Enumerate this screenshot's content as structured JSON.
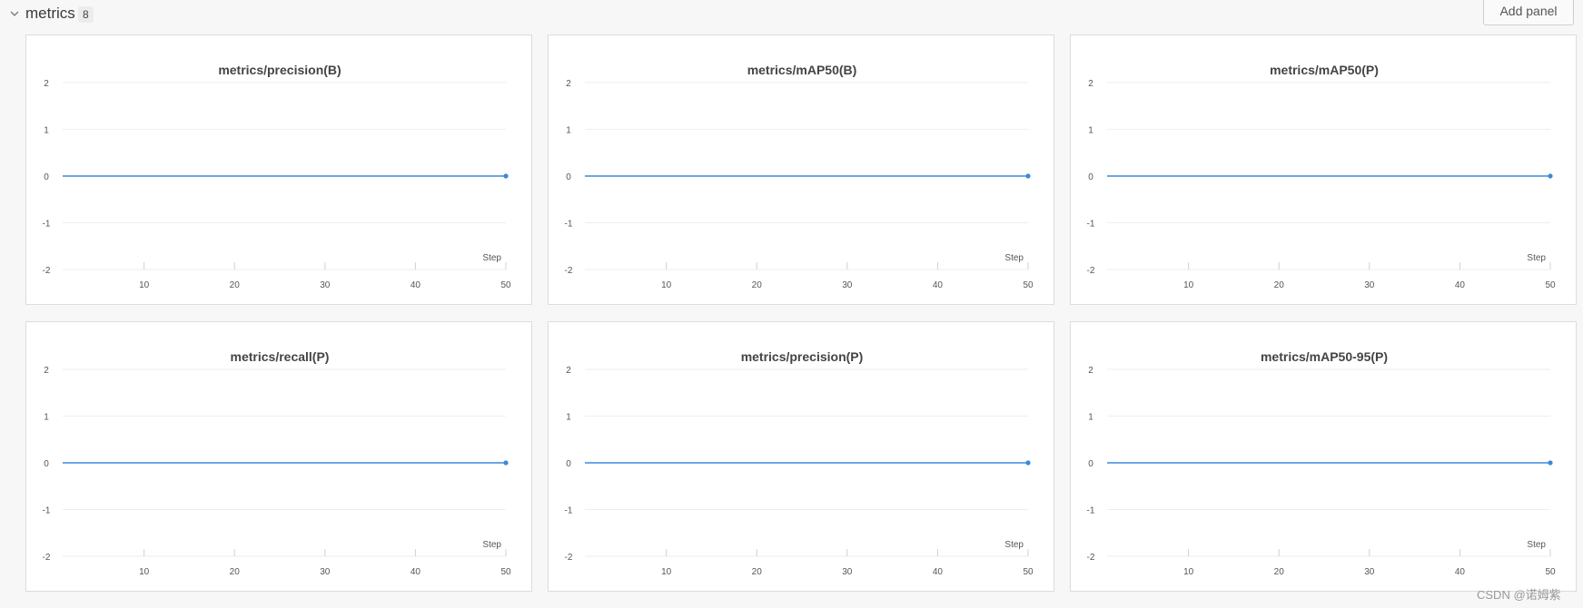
{
  "section": {
    "title": "metrics",
    "count": "8",
    "add_panel_label": "Add panel"
  },
  "colors": {
    "line": "#3a8ad6",
    "grid": "#eeeeee",
    "axis_text": "#555555"
  },
  "chart_data": [
    {
      "type": "line",
      "title": "metrics/precision(B)",
      "xlabel": "Step",
      "ylabel": "",
      "ylim": [
        -2,
        2
      ],
      "xlim": [
        1,
        50
      ],
      "yticks": [
        2,
        1,
        0,
        -1,
        -2
      ],
      "xticks": [
        10,
        20,
        30,
        40,
        50
      ],
      "grid": "horizontal",
      "series": [
        {
          "x": [
            1,
            50
          ],
          "y": [
            0,
            0
          ]
        }
      ]
    },
    {
      "type": "line",
      "title": "metrics/mAP50(B)",
      "xlabel": "Step",
      "ylabel": "",
      "ylim": [
        -2,
        2
      ],
      "xlim": [
        1,
        50
      ],
      "yticks": [
        2,
        1,
        0,
        -1,
        -2
      ],
      "xticks": [
        10,
        20,
        30,
        40,
        50
      ],
      "grid": "horizontal",
      "series": [
        {
          "x": [
            1,
            50
          ],
          "y": [
            0,
            0
          ]
        }
      ]
    },
    {
      "type": "line",
      "title": "metrics/mAP50(P)",
      "xlabel": "Step",
      "ylabel": "",
      "ylim": [
        -2,
        2
      ],
      "xlim": [
        1,
        50
      ],
      "yticks": [
        2,
        1,
        0,
        -1,
        -2
      ],
      "xticks": [
        10,
        20,
        30,
        40,
        50
      ],
      "grid": "horizontal",
      "series": [
        {
          "x": [
            1,
            50
          ],
          "y": [
            0,
            0
          ]
        }
      ]
    },
    {
      "type": "line",
      "title": "metrics/recall(P)",
      "xlabel": "Step",
      "ylabel": "",
      "ylim": [
        -2,
        2
      ],
      "xlim": [
        1,
        50
      ],
      "yticks": [
        2,
        1,
        0,
        -1,
        -2
      ],
      "xticks": [
        10,
        20,
        30,
        40,
        50
      ],
      "grid": "horizontal",
      "series": [
        {
          "x": [
            1,
            50
          ],
          "y": [
            0,
            0
          ]
        }
      ]
    },
    {
      "type": "line",
      "title": "metrics/precision(P)",
      "xlabel": "Step",
      "ylabel": "",
      "ylim": [
        -2,
        2
      ],
      "xlim": [
        1,
        50
      ],
      "yticks": [
        2,
        1,
        0,
        -1,
        -2
      ],
      "xticks": [
        10,
        20,
        30,
        40,
        50
      ],
      "grid": "horizontal",
      "series": [
        {
          "x": [
            1,
            50
          ],
          "y": [
            0,
            0
          ]
        }
      ]
    },
    {
      "type": "line",
      "title": "metrics/mAP50-95(P)",
      "xlabel": "Step",
      "ylabel": "",
      "ylim": [
        -2,
        2
      ],
      "xlim": [
        1,
        50
      ],
      "yticks": [
        2,
        1,
        0,
        -1,
        -2
      ],
      "xticks": [
        10,
        20,
        30,
        40,
        50
      ],
      "grid": "horizontal",
      "series": [
        {
          "x": [
            1,
            50
          ],
          "y": [
            0,
            0
          ]
        }
      ]
    }
  ],
  "watermark": "CSDN @诺姆紫"
}
